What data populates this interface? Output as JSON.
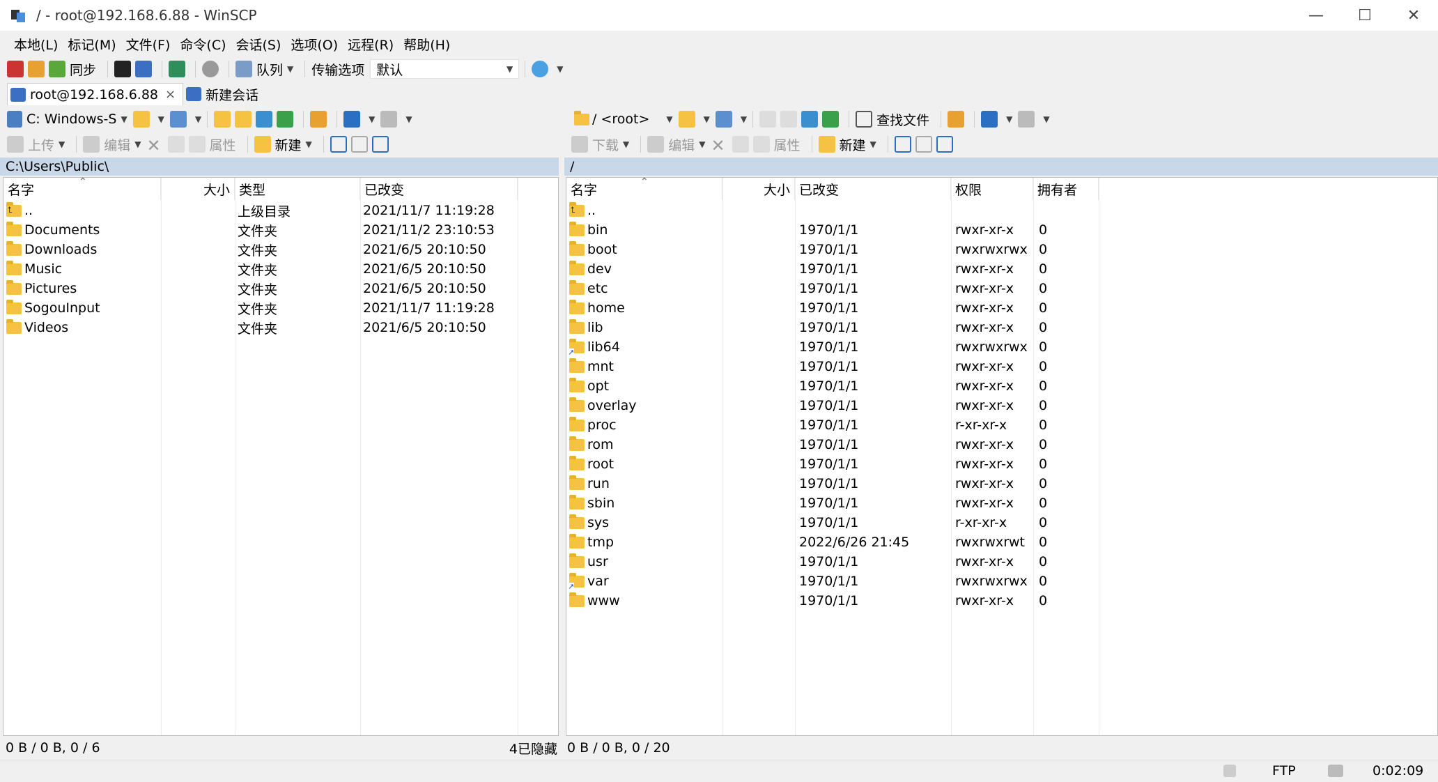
{
  "window": {
    "title": "/ - root@192.168.6.88 - WinSCP",
    "minimize": "—",
    "maximize": "☐",
    "close": "✕"
  },
  "menu": [
    "本地(L)",
    "标记(M)",
    "文件(F)",
    "命令(C)",
    "会话(S)",
    "选项(O)",
    "远程(R)",
    "帮助(H)"
  ],
  "toolbar": {
    "sync_label": "同步",
    "queue_label": "队列",
    "transfer_label": "传输选项",
    "transfer_value": "默认"
  },
  "tabs": [
    {
      "label": "root@192.168.6.88",
      "close": "×"
    },
    {
      "label": "新建会话"
    }
  ],
  "left": {
    "drive": "C: Windows-S",
    "upload_label": "上传",
    "edit_label": "编辑",
    "props_label": "属性",
    "new_label": "新建",
    "path": "C:\\Users\\Public\\",
    "columns": {
      "name": "名字",
      "size": "大小",
      "type": "类型",
      "changed": "已改变"
    },
    "files": [
      {
        "name": "..",
        "type": "上级目录",
        "changed": "2021/11/7  11:19:28",
        "icon": "up"
      },
      {
        "name": "Documents",
        "type": "文件夹",
        "changed": "2021/11/2  23:10:53",
        "icon": "folder"
      },
      {
        "name": "Downloads",
        "type": "文件夹",
        "changed": "2021/6/5  20:10:50",
        "icon": "folder"
      },
      {
        "name": "Music",
        "type": "文件夹",
        "changed": "2021/6/5  20:10:50",
        "icon": "folder"
      },
      {
        "name": "Pictures",
        "type": "文件夹",
        "changed": "2021/6/5  20:10:50",
        "icon": "folder"
      },
      {
        "name": "SogouInput",
        "type": "文件夹",
        "changed": "2021/11/7  11:19:28",
        "icon": "folder"
      },
      {
        "name": "Videos",
        "type": "文件夹",
        "changed": "2021/6/5  20:10:50",
        "icon": "folder"
      }
    ],
    "status": "0 B / 0 B,  0 / 6",
    "hidden": "4已隐藏"
  },
  "right": {
    "dir": "/ <root>",
    "find_label": "查找文件",
    "download_label": "下载",
    "edit_label": "编辑",
    "props_label": "属性",
    "new_label": "新建",
    "path": "/",
    "columns": {
      "name": "名字",
      "size": "大小",
      "changed": "已改变",
      "rights": "权限",
      "owner": "拥有者"
    },
    "files": [
      {
        "name": "..",
        "changed": "",
        "rights": "",
        "owner": "",
        "icon": "up"
      },
      {
        "name": "bin",
        "changed": "1970/1/1",
        "rights": "rwxr-xr-x",
        "owner": "0",
        "icon": "folder"
      },
      {
        "name": "boot",
        "changed": "1970/1/1",
        "rights": "rwxrwxrwx",
        "owner": "0",
        "icon": "folder"
      },
      {
        "name": "dev",
        "changed": "1970/1/1",
        "rights": "rwxr-xr-x",
        "owner": "0",
        "icon": "folder"
      },
      {
        "name": "etc",
        "changed": "1970/1/1",
        "rights": "rwxr-xr-x",
        "owner": "0",
        "icon": "folder"
      },
      {
        "name": "home",
        "changed": "1970/1/1",
        "rights": "rwxr-xr-x",
        "owner": "0",
        "icon": "folder"
      },
      {
        "name": "lib",
        "changed": "1970/1/1",
        "rights": "rwxr-xr-x",
        "owner": "0",
        "icon": "folder"
      },
      {
        "name": "lib64",
        "changed": "1970/1/1",
        "rights": "rwxrwxrwx",
        "owner": "0",
        "icon": "link"
      },
      {
        "name": "mnt",
        "changed": "1970/1/1",
        "rights": "rwxr-xr-x",
        "owner": "0",
        "icon": "folder"
      },
      {
        "name": "opt",
        "changed": "1970/1/1",
        "rights": "rwxr-xr-x",
        "owner": "0",
        "icon": "folder"
      },
      {
        "name": "overlay",
        "changed": "1970/1/1",
        "rights": "rwxr-xr-x",
        "owner": "0",
        "icon": "folder"
      },
      {
        "name": "proc",
        "changed": "1970/1/1",
        "rights": "r-xr-xr-x",
        "owner": "0",
        "icon": "folder"
      },
      {
        "name": "rom",
        "changed": "1970/1/1",
        "rights": "rwxr-xr-x",
        "owner": "0",
        "icon": "folder"
      },
      {
        "name": "root",
        "changed": "1970/1/1",
        "rights": "rwxr-xr-x",
        "owner": "0",
        "icon": "folder"
      },
      {
        "name": "run",
        "changed": "1970/1/1",
        "rights": "rwxr-xr-x",
        "owner": "0",
        "icon": "folder"
      },
      {
        "name": "sbin",
        "changed": "1970/1/1",
        "rights": "rwxr-xr-x",
        "owner": "0",
        "icon": "folder"
      },
      {
        "name": "sys",
        "changed": "1970/1/1",
        "rights": "r-xr-xr-x",
        "owner": "0",
        "icon": "folder"
      },
      {
        "name": "tmp",
        "changed": "2022/6/26 21:45",
        "rights": "rwxrwxrwt",
        "owner": "0",
        "icon": "folder"
      },
      {
        "name": "usr",
        "changed": "1970/1/1",
        "rights": "rwxr-xr-x",
        "owner": "0",
        "icon": "folder"
      },
      {
        "name": "var",
        "changed": "1970/1/1",
        "rights": "rwxrwxrwx",
        "owner": "0",
        "icon": "link"
      },
      {
        "name": "www",
        "changed": "1970/1/1",
        "rights": "rwxr-xr-x",
        "owner": "0",
        "icon": "folder"
      }
    ],
    "status": "0 B / 0 B,  0 / 20"
  },
  "statusbar": {
    "protocol": "FTP",
    "elapsed": "0:02:09"
  }
}
